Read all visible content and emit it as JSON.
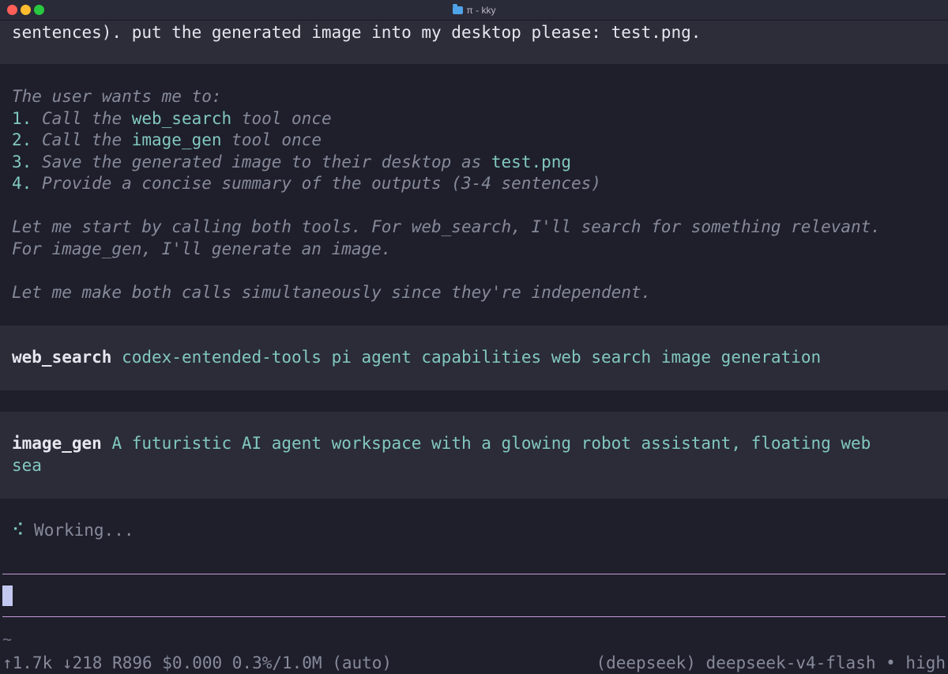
{
  "window": {
    "title": "π - kky"
  },
  "user_message": {
    "text": "sentences). put the generated image into my desktop please: test.png."
  },
  "thinking": {
    "intro": "The user wants me to:",
    "steps": [
      {
        "num": "1.",
        "before": " Call the ",
        "highlight": "web_search",
        "after": " tool once"
      },
      {
        "num": "2.",
        "before": " Call the ",
        "highlight": "image_gen",
        "after": " tool once"
      },
      {
        "num": "3.",
        "before": " Save the generated image to their desktop as ",
        "highlight": "test.png",
        "after": ""
      },
      {
        "num": "4.",
        "before": " Provide a concise summary of the outputs (3-4 sentences)",
        "highlight": "",
        "after": ""
      }
    ],
    "para1_line1": "Let me start by calling both tools. For web_search, I'll search for something relevant.",
    "para1_line2": "For image_gen, I'll generate an image.",
    "para2": "Let me make both calls simultaneously since they're independent."
  },
  "tool_calls": {
    "web_search": {
      "name": "web_search",
      "args": "codex-entended-tools pi agent capabilities web search image generation"
    },
    "image_gen": {
      "name": "image_gen",
      "args_line1": "A futuristic AI agent workspace with a glowing robot assistant, floating web",
      "args_line2": "sea"
    }
  },
  "status": {
    "spinner": "⠪",
    "text": "Working..."
  },
  "prompt": {
    "tilde": "~"
  },
  "footer": {
    "stats": "↑1.7k ↓218 R896 $0.000 0.3%/1.0M (auto)",
    "model": "(deepseek) deepseek-v4-flash • high"
  },
  "colors": {
    "background": "#1e1f2b",
    "accent_teal": "#82c8c0",
    "input_border": "#c49bd6",
    "cursor": "#c3c8f0"
  }
}
